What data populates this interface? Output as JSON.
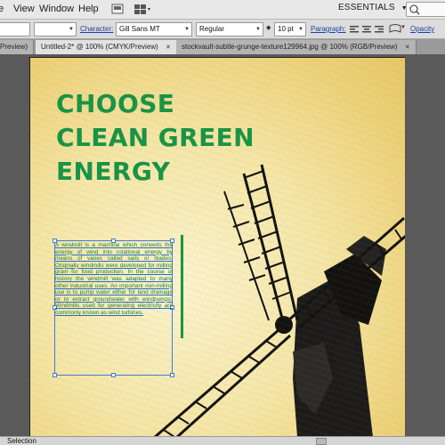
{
  "menubar": {
    "items": [
      "File",
      "View",
      "Window",
      "Help"
    ],
    "workspace_label": "ESSENTIALS"
  },
  "control_bar": {
    "character_label": "Character:",
    "font_family": "Gill Sans MT",
    "font_style": "Regular",
    "font_size": "10 pt",
    "paragraph_label": "Paragraph:",
    "opacity_label": "Opacity"
  },
  "tabs": [
    {
      "label": "Preview)",
      "active": false
    },
    {
      "label": "Untitled-2* @ 100% (CMYK/Preview)",
      "active": true
    },
    {
      "label": "stockvault-subtle-grunge-texture129964.jpg @ 100% (RGB/Preview)",
      "active": false
    }
  ],
  "artboard": {
    "headline": [
      "CHOOSE",
      "CLEAN GREEN",
      "ENERGY"
    ],
    "body": "A windmill is a machine which converts the energy of wind into rotational energy by means of vanes called sails or blades. Originally windmills were developed for milling grain for food production. In the course of history the windmill was adapted to many other industrial uses. An important non-milling use is to pump water either for land drainage or to extract groundwater with windpumps. Windmills used for generating electricity are commonly known as wind turbines."
  },
  "status": {
    "tool": "Selection"
  },
  "colors": {
    "headline_green": "#159447",
    "selection_blue": "#3d7ad8"
  }
}
